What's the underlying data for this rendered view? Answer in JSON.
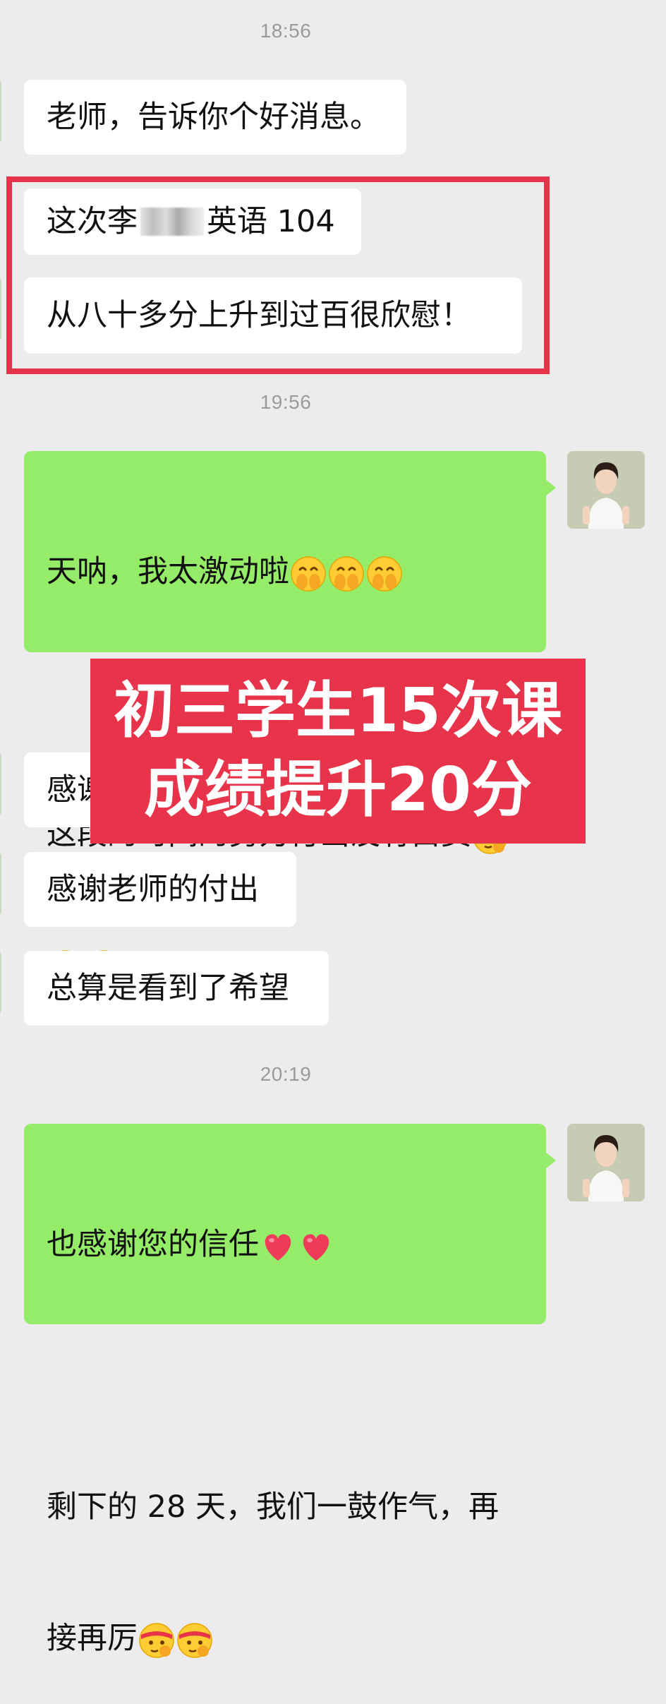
{
  "timestamps": [
    "18:56",
    "19:56",
    "20:19"
  ],
  "messages_1": {
    "m1": "老师，告诉你个好消息。",
    "m2_prefix": "这次李",
    "m2_suffix": "英语 104",
    "m3": "从八十多分上升到过百很欣慰！"
  },
  "reply_1": {
    "line1": "天呐，我太激动啦",
    "line2": "这段的时间的努力付出没有白费"
  },
  "messages_2": {
    "m4_visible": "感谢",
    "m5": "感谢老师的付出",
    "m6": "总算是看到了希望"
  },
  "reply_2": {
    "line1": "也感谢您的信任",
    "line2": "剩下的 28 天，我们一鼓作气，再",
    "line3": "接再厉"
  },
  "promo": {
    "line1": "初三学生15次课",
    "line2": "成绩提升20分"
  },
  "colors": {
    "background": "#ececec",
    "incoming_bubble": "#ffffff",
    "outgoing_bubble": "#95ec69",
    "highlight_red": "#e8344a",
    "timestamp_gray": "#9b9b9b"
  },
  "icons": {
    "excited": "hands-over-mouth-emoji",
    "determined": "saluting-headband-emoji",
    "heart": "red-heart-emoji"
  }
}
